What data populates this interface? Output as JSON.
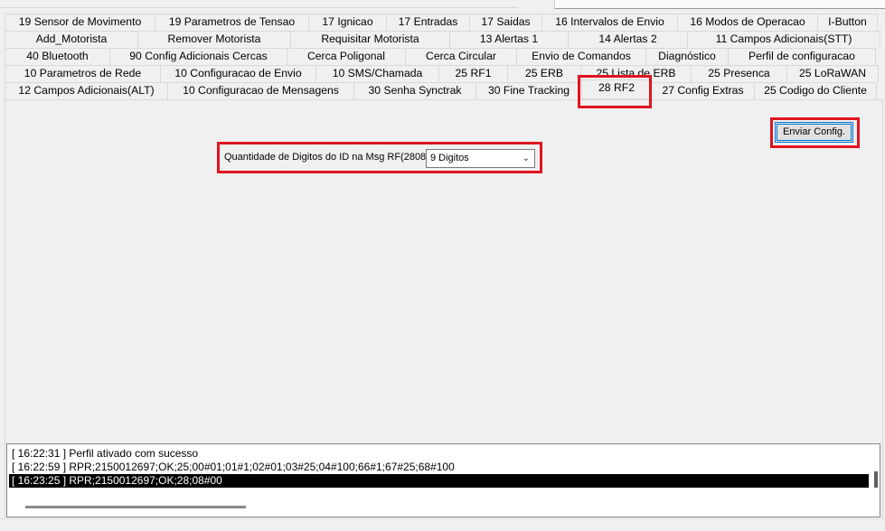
{
  "tabs": {
    "row1": [
      "19 Sensor de Movimento",
      "19 Parametros de Tensao",
      "17 Ignicao",
      "17 Entradas",
      "17 Saidas",
      "16 Intervalos de Envio",
      "16 Modos de Operacao",
      "I-Button"
    ],
    "row2": [
      "Add_Motorista",
      "Remover Motorista",
      "Requisitar Motorista",
      "13 Alertas 1",
      "14 Alertas 2",
      "11 Campos Adicionais(STT)"
    ],
    "row3": [
      "40 Bluetooth",
      "90 Config Adicionais Cercas",
      "Cerca Poligonal",
      "Cerca Circular",
      "Envio de Comandos",
      "Diagnóstico",
      "Perfil de configuracao"
    ],
    "row4": [
      "10 Parametros de Rede",
      "10 Configuracao de Envio",
      "10 SMS/Chamada",
      "25 RF1",
      "25 ERB",
      "25 Lista de ERB",
      "25 Presenca",
      "25 LoRaWAN"
    ],
    "row5": [
      "12 Campos Adicionais(ALT)",
      "10 Configuracao de Mensagens",
      "30 Senha Synctrak",
      "30 Fine Tracking",
      "28 RF2",
      "27 Config Extras",
      "25 Codigo do Cliente"
    ]
  },
  "panel": {
    "send_button": "Enviar Config.",
    "digits_label": "Quantidade de Digitos do ID na Msg RF(2808)",
    "digits_value": "9 Digitos"
  },
  "log": [
    "[ 16:22:31 ] Perfil ativado com sucesso",
    "[ 16:22:59 ] RPR;2150012697;OK;25;00#01;01#1;02#01;03#25;04#100;66#1;67#25;68#100",
    "[ 16:23:25 ] RPR;2150012697;OK;28;08#00"
  ],
  "colors": {
    "highlight": "#e0141e",
    "accent": "#0078d7"
  }
}
